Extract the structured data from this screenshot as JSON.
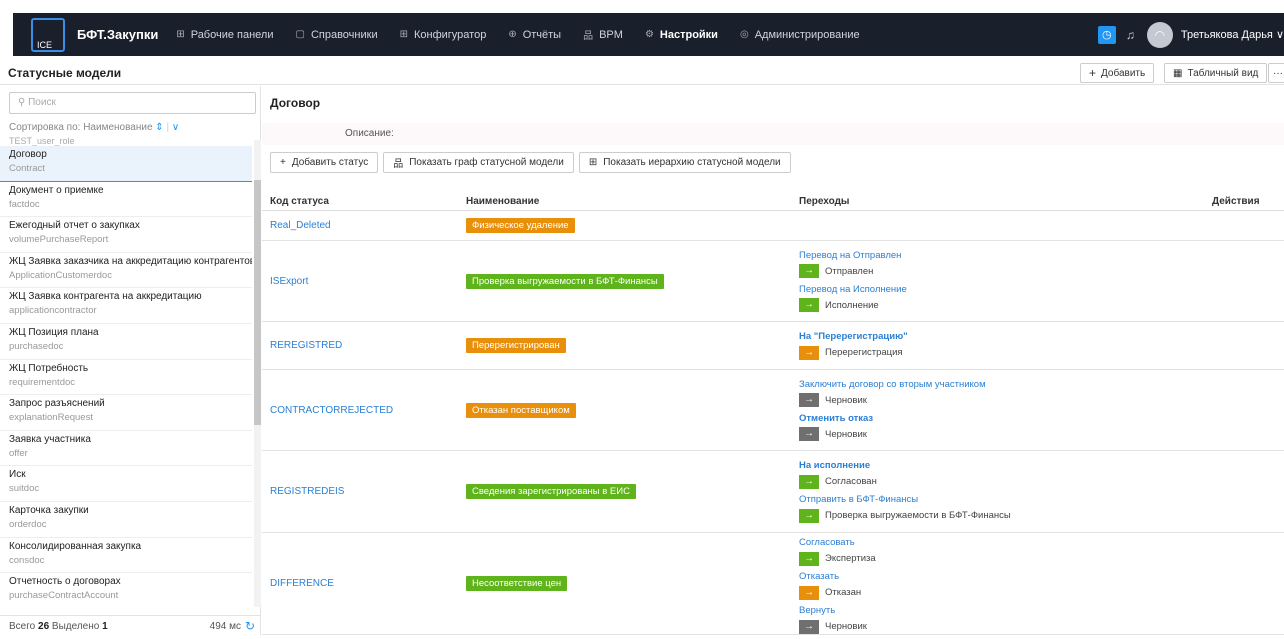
{
  "app": {
    "brand": "БФТ.Закупки",
    "logo_text": "ICE",
    "nav": [
      {
        "label": "Рабочие панели",
        "icon": "grid-icon",
        "glyph": "⊞"
      },
      {
        "label": "Справочники",
        "icon": "book-icon",
        "glyph": "▢"
      },
      {
        "label": "Конфигуратор",
        "icon": "grid-icon",
        "glyph": "⊞"
      },
      {
        "label": "Отчёты",
        "icon": "report-icon",
        "glyph": "⊕"
      },
      {
        "label": "BPM",
        "icon": "hierarchy-icon",
        "glyph": "品"
      },
      {
        "label": "Настройки",
        "icon": "gear-icon",
        "glyph": "⚙"
      },
      {
        "label": "Администрирование",
        "icon": "shield-icon",
        "glyph": "◎"
      }
    ],
    "active_nav": "Настройки",
    "user_name": "Третьякова Дарья"
  },
  "page": {
    "title": "Статусные модели",
    "add_label": "Добавить",
    "table_view_label": "Табличный вид",
    "more_label": "···"
  },
  "left": {
    "search_placeholder": "Поиск",
    "sort_label": "Сортировка по: Наименование",
    "cut_item": "TEST_user_role",
    "items": [
      {
        "name": "Договор",
        "code": "Contract",
        "selected": true
      },
      {
        "name": "Документ о приемке",
        "code": "factdoc"
      },
      {
        "name": "Ежегодный отчет о закупках",
        "code": "volumePurchaseReport"
      },
      {
        "name": "ЖЦ Заявка заказчика на аккредитацию контрагентов",
        "code": "ApplicationCustomerdoc"
      },
      {
        "name": "ЖЦ Заявка контрагента на аккредитацию",
        "code": "applicationcontractor"
      },
      {
        "name": "ЖЦ Позиция плана",
        "code": "purchasedoc"
      },
      {
        "name": "ЖЦ Потребность",
        "code": "requirementdoc"
      },
      {
        "name": "Запрос разъяснений",
        "code": "explanationRequest"
      },
      {
        "name": "Заявка участника",
        "code": "offer"
      },
      {
        "name": "Иск",
        "code": "suitdoc"
      },
      {
        "name": "Карточка закупки",
        "code": "orderdoc"
      },
      {
        "name": "Консолидированная закупка",
        "code": "consdoc"
      },
      {
        "name": "Отчетность о договорах",
        "code": "purchaseContractAccount"
      }
    ],
    "total_label": "Всего",
    "total": "26",
    "selected_label": "Выделено",
    "selected": "1",
    "time": "494 мс"
  },
  "right": {
    "title": "Договор",
    "description_label": "Описание:",
    "buttons": {
      "add_status": "Добавить статус",
      "show_graph": "Показать граф статусной модели",
      "show_hierarchy": "Показать иерархию статусной модели"
    },
    "columns": {
      "code": "Код статуса",
      "name": "Наименование",
      "transitions": "Переходы",
      "actions": "Действия"
    },
    "rows": [
      {
        "code": "Real_Deleted",
        "name": "Физическое удаление",
        "color": "#e8900c",
        "transitions": []
      },
      {
        "code": "ISExport",
        "name": "Проверка выгружаемости в БФТ-Финансы",
        "color": "#5fb31b",
        "transitions": [
          {
            "link": "Перевод на Отправлен",
            "bold": false,
            "target": "Отправлен",
            "target_color": "#5fb31b"
          },
          {
            "link": "Перевод на Исполнение",
            "bold": false,
            "target": "Исполнение",
            "target_color": "#5fb31b"
          }
        ]
      },
      {
        "code": "REREGISTRED",
        "name": "Перерегистрирован",
        "color": "#e8900c",
        "transitions": [
          {
            "link": "На \"Перерегистрацию\"",
            "bold": true,
            "target": "Перерегистрация",
            "target_color": "#e8900c"
          }
        ]
      },
      {
        "code": "CONTRACTORREJECTED",
        "name": "Отказан поставщиком",
        "color": "#e8900c",
        "transitions": [
          {
            "link": "Заключить договор со вторым участником",
            "bold": false,
            "target": "Черновик",
            "target_color": "#6f6f6f"
          },
          {
            "link": "Отменить отказ",
            "bold": true,
            "target": "Черновик",
            "target_color": "#6f6f6f"
          }
        ]
      },
      {
        "code": "REGISTREDEIS",
        "name": "Сведения зарегистрированы в ЕИС",
        "color": "#5fb31b",
        "transitions": [
          {
            "link": "На исполнение",
            "bold": true,
            "target": "Согласован",
            "target_color": "#5fb31b"
          },
          {
            "link": "Отправить в БФТ-Финансы",
            "bold": false,
            "target": "Проверка выгружаемости в БФТ-Финансы",
            "target_color": "#5fb31b"
          }
        ]
      },
      {
        "code": "DIFFERENCE",
        "name": "Несоответствие цен",
        "color": "#5fb31b",
        "transitions": [
          {
            "link": "Согласовать",
            "bold": false,
            "target": "Экспертиза",
            "target_color": "#5fb31b"
          },
          {
            "link": "Отказать",
            "bold": false,
            "target": "Отказан",
            "target_color": "#e8900c"
          },
          {
            "link": "Вернуть",
            "bold": false,
            "target": "Черновик",
            "target_color": "#6f6f6f"
          }
        ]
      }
    ]
  }
}
